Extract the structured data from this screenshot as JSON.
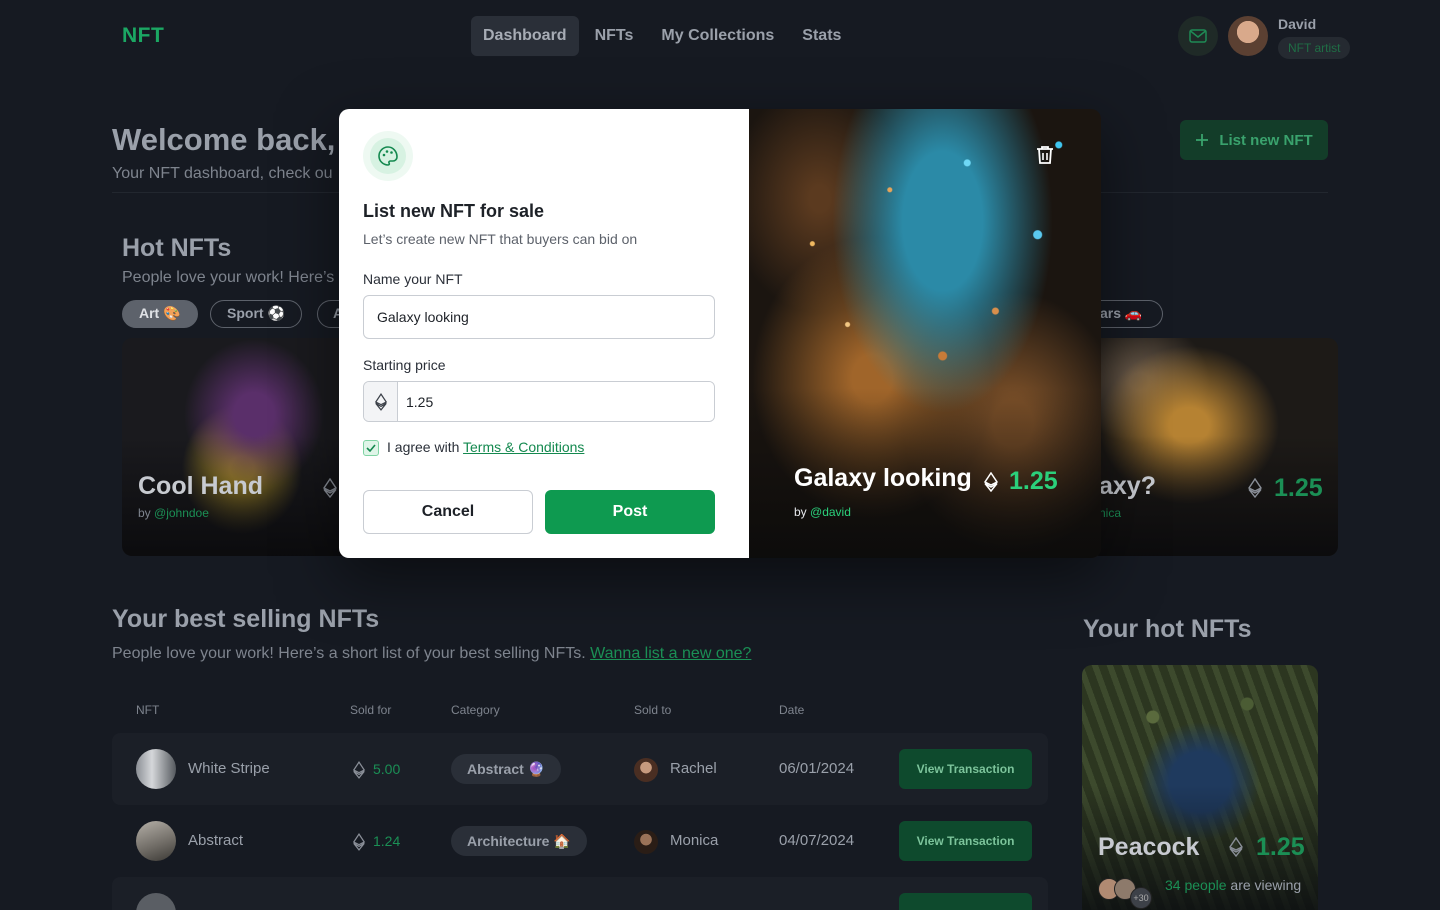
{
  "app": {
    "logo": "NFT"
  },
  "nav": {
    "items": [
      "Dashboard",
      "NFTs",
      "My Collections",
      "Stats"
    ],
    "active": "Dashboard"
  },
  "user": {
    "name": "David",
    "badge": "NFT artist"
  },
  "welcome": {
    "title": "Welcome back,",
    "subtitle": "Your NFT dashboard, check ou"
  },
  "list_button": "List new NFT",
  "hot": {
    "title": "Hot NFTs",
    "subtitle": "People love your work! Here’s",
    "chips": [
      "Art 🎨",
      "Sport ⚽",
      "A",
      "ars 🚗"
    ],
    "cards": [
      {
        "title": "Cool Hand",
        "by_prefix": "by ",
        "by": "@johndoe"
      },
      {
        "title": "axy?",
        "by": "nica",
        "price": "1.25"
      }
    ]
  },
  "modal": {
    "title": "List new NFT for sale",
    "subtitle": "Let’s create new NFT that buyers can bid on",
    "name_label": "Name your NFT",
    "name_value": "Galaxy looking",
    "price_label": "Starting price",
    "price_value": "1.25",
    "agree_text": "I agree with ",
    "terms_link": "Terms & Conditions",
    "cancel": "Cancel",
    "post": "Post",
    "preview": {
      "title": "Galaxy looking",
      "price": "1.25",
      "by_prefix": "by ",
      "by": "@david"
    }
  },
  "best": {
    "title": "Your best selling NFTs",
    "subtitle": "People love your work! Here’s a short list of your best selling NFTs. ",
    "link": "Wanna list a new one?",
    "headers": [
      "NFT",
      "Sold for",
      "Category",
      "Sold to",
      "Date"
    ],
    "rows": [
      {
        "name": "White Stripe",
        "price": "5.00",
        "category": "Abstract 🔮",
        "buyer": "Rachel",
        "date": "06/01/2024",
        "action": "View Transaction"
      },
      {
        "name": "Abstract",
        "price": "1.24",
        "category": "Architecture 🏠",
        "buyer": "Monica",
        "date": "04/07/2024",
        "action": "View Transaction"
      }
    ]
  },
  "your_hot": {
    "title": "Your hot NFTs",
    "card": {
      "title": "Peacock",
      "price": "1.25",
      "viewers_count": "+30",
      "viewers_link": "34 people",
      "viewers_text": " are viewing"
    }
  },
  "colors": {
    "accent": "#0e9a50",
    "bg": "#161a22",
    "price_green": "#2bd07b"
  }
}
